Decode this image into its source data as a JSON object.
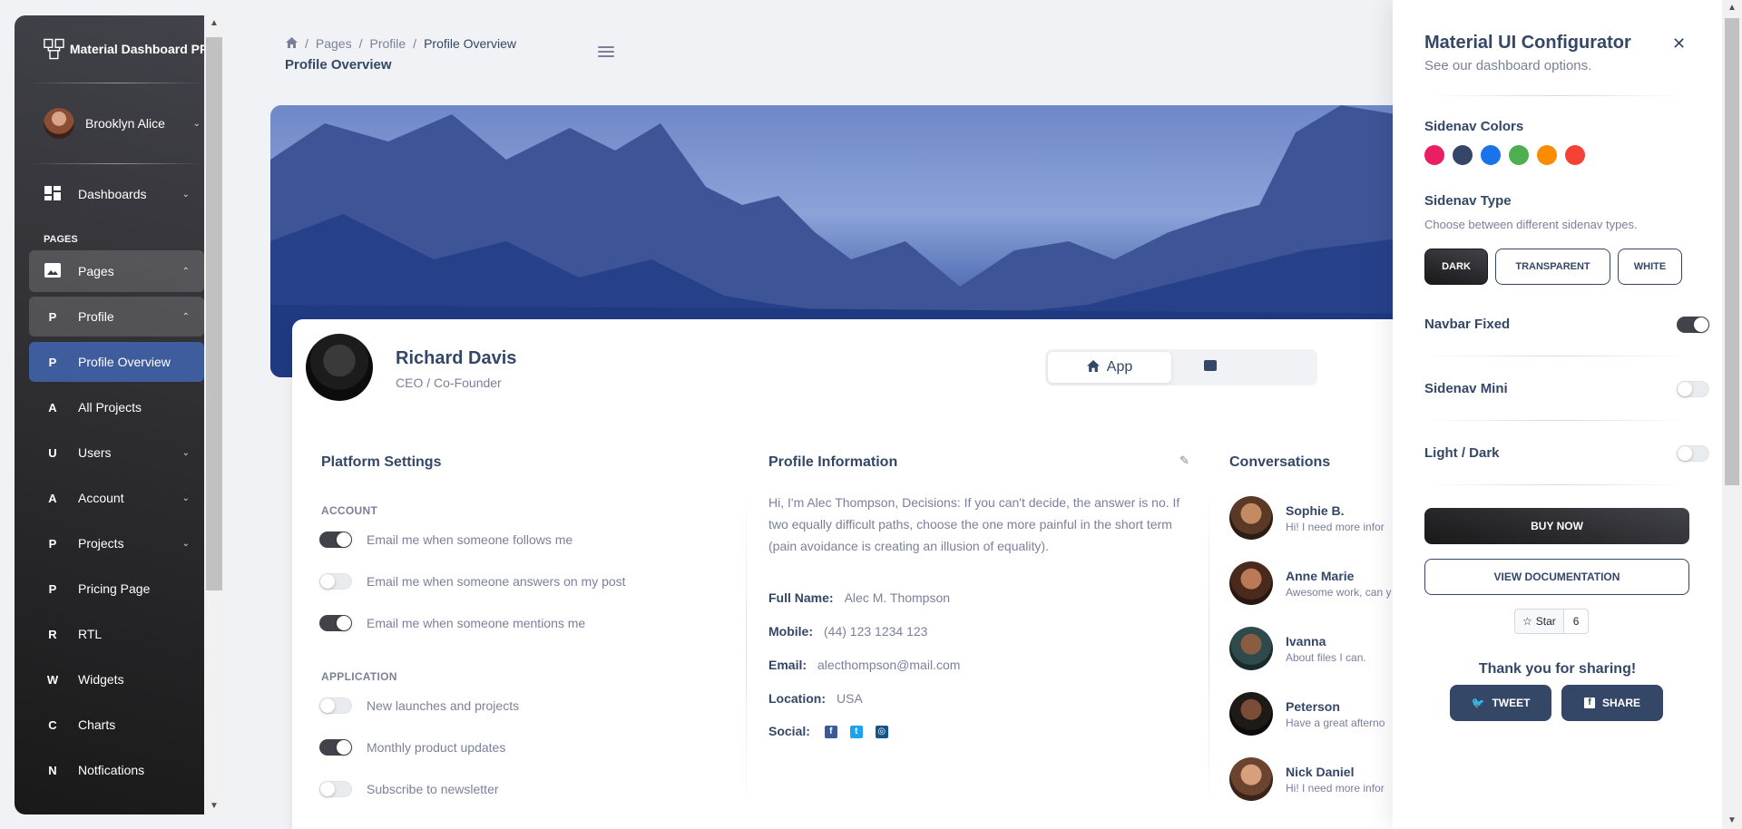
{
  "sidebar": {
    "brand": "Material Dashboard PRO",
    "user": "Brooklyn Alice",
    "section_label": "PAGES",
    "items": [
      {
        "icon": "dashboard-icon",
        "glyph": "▦",
        "label": "Dashboards"
      },
      {
        "icon": "image-icon",
        "glyph": "▣",
        "label": "Pages"
      },
      {
        "icon": "P",
        "glyph": "P",
        "label": "Profile"
      },
      {
        "icon": "P",
        "glyph": "P",
        "label": "Profile Overview"
      },
      {
        "icon": "A",
        "glyph": "A",
        "label": "All Projects"
      },
      {
        "icon": "U",
        "glyph": "U",
        "label": "Users"
      },
      {
        "icon": "A",
        "glyph": "A",
        "label": "Account"
      },
      {
        "icon": "P",
        "glyph": "P",
        "label": "Projects"
      },
      {
        "icon": "P",
        "glyph": "P",
        "label": "Pricing Page"
      },
      {
        "icon": "R",
        "glyph": "R",
        "label": "RTL"
      },
      {
        "icon": "W",
        "glyph": "W",
        "label": "Widgets"
      },
      {
        "icon": "C",
        "glyph": "C",
        "label": "Charts"
      },
      {
        "icon": "N",
        "glyph": "N",
        "label": "Notfications"
      }
    ]
  },
  "header": {
    "breadcrumb": [
      "Pages",
      "Profile",
      "Profile Overview"
    ],
    "title": "Profile Overview"
  },
  "profile": {
    "name": "Richard Davis",
    "role": "CEO / Co-Founder",
    "tab_app": "App"
  },
  "platform_settings": {
    "title": "Platform Settings",
    "account_label": "ACCOUNT",
    "application_label": "APPLICATION",
    "account": [
      {
        "label": "Email me when someone follows me",
        "on": true
      },
      {
        "label": "Email me when someone answers on my post",
        "on": false
      },
      {
        "label": "Email me when someone mentions me",
        "on": true
      }
    ],
    "application": [
      {
        "label": "New launches and projects",
        "on": false
      },
      {
        "label": "Monthly product updates",
        "on": true
      },
      {
        "label": "Subscribe to newsletter",
        "on": false
      }
    ]
  },
  "profile_info": {
    "title": "Profile Information",
    "bio": "Hi, I'm Alec Thompson, Decisions: If you can't decide, the answer is no. If two equally difficult paths, choose the one more painful in the short term (pain avoidance is creating an illusion of equality).",
    "rows": [
      {
        "key": "Full Name:",
        "value": "Alec M. Thompson"
      },
      {
        "key": "Mobile:",
        "value": "(44) 123 1234 123"
      },
      {
        "key": "Email:",
        "value": "alecthompson@mail.com"
      },
      {
        "key": "Location:",
        "value": "USA"
      }
    ],
    "social_label": "Social:"
  },
  "conversations": {
    "title": "Conversations",
    "items": [
      {
        "name": "Sophie B.",
        "message": "Hi! I need more infor"
      },
      {
        "name": "Anne Marie",
        "message": "Awesome work, can y"
      },
      {
        "name": "Ivanna",
        "message": "About files I can."
      },
      {
        "name": "Peterson",
        "message": "Have a great afterno"
      },
      {
        "name": "Nick Daniel",
        "message": "Hi! I need more infor"
      }
    ]
  },
  "configurator": {
    "title": "Material UI Configurator",
    "subtitle": "See our dashboard options.",
    "sidenav_colors_label": "Sidenav Colors",
    "colors": [
      "#e91e63",
      "#344767",
      "#1a73e8",
      "#4caf50",
      "#fb8c00",
      "#f44335"
    ],
    "sidenav_type_label": "Sidenav Type",
    "sidenav_type_desc": "Choose between different sidenav types.",
    "type_buttons": [
      "DARK",
      "TRANSPARENT",
      "WHITE"
    ],
    "navbar_fixed": "Navbar Fixed",
    "sidenav_mini": "Sidenav Mini",
    "light_dark": "Light / Dark",
    "buy_now": "BUY NOW",
    "view_docs": "VIEW DOCUMENTATION",
    "star_label": "Star",
    "star_count": "6",
    "thanks": "Thank you for sharing!",
    "tweet": "TWEET",
    "share": "SHARE"
  }
}
